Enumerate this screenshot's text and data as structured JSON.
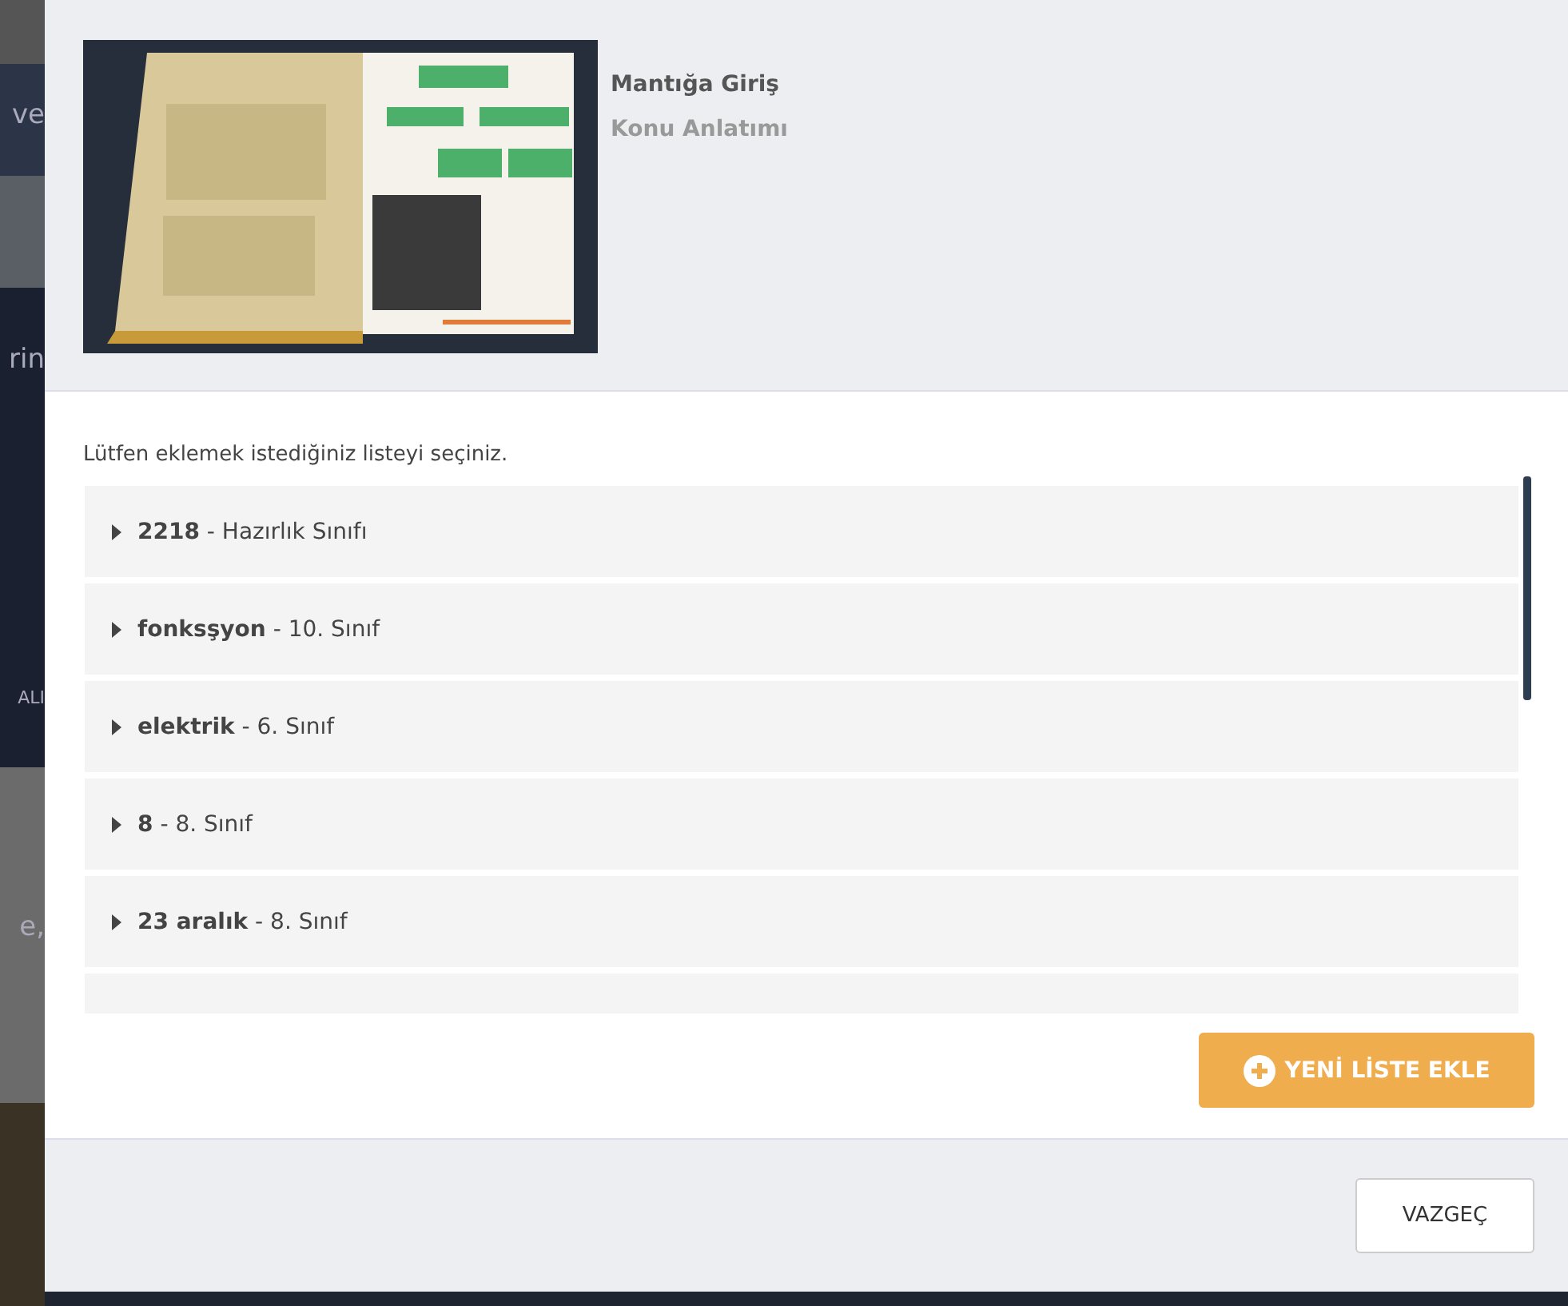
{
  "background_fragments": [
    "ve",
    "rin",
    "ALI",
    "e,"
  ],
  "header": {
    "title": "Mantığa Giriş",
    "subtitle": "Konu Anlatımı"
  },
  "prompt": "Lütfen eklemek istediğiniz listeyi seçiniz.",
  "lists": [
    {
      "name": "2218",
      "detail": "- Hazırlık Sınıfı"
    },
    {
      "name": "fonksşyon",
      "detail": "- 10. Sınıf"
    },
    {
      "name": "elektrik",
      "detail": "- 6. Sınıf"
    },
    {
      "name": "8",
      "detail": "- 8. Sınıf"
    },
    {
      "name": "23 aralık",
      "detail": "- 8. Sınıf"
    }
  ],
  "new_list_button": "YENİ LİSTE EKLE",
  "cancel_button": "VAZGEÇ"
}
